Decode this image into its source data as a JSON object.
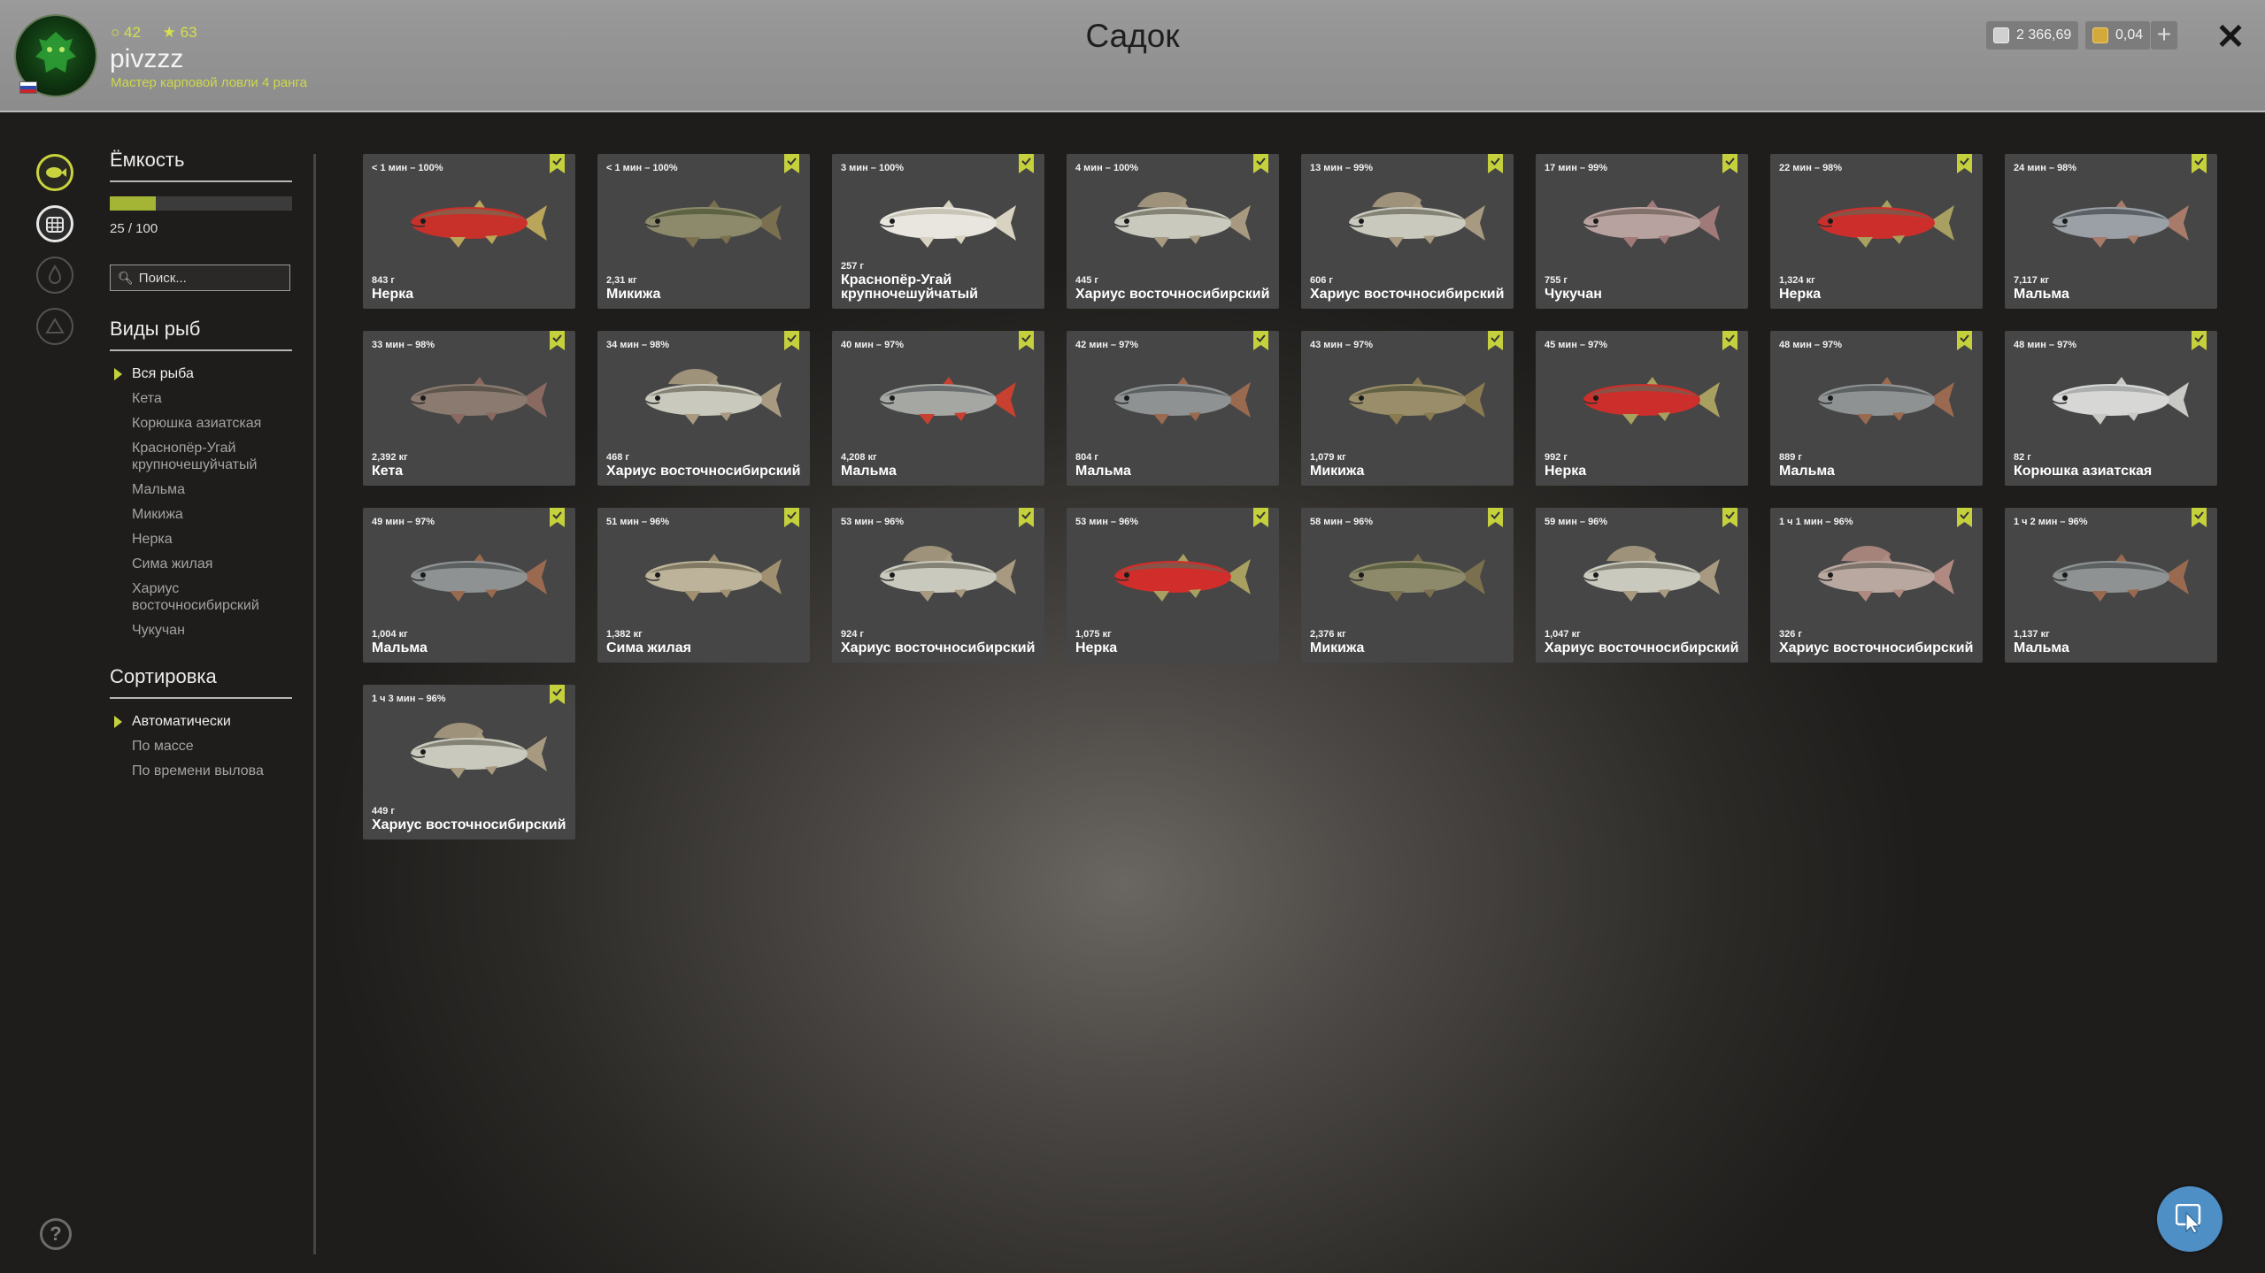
{
  "header": {
    "title": "Садок",
    "player": {
      "username": "pivzzz",
      "rank_text": "Мастер карповой ловли 4 ранга",
      "stat1": "42",
      "stat2": "63"
    },
    "currency": {
      "silver": "2 366,69",
      "gold": "0,04"
    },
    "plus_label": "+",
    "close_label": "✕",
    "accent_color": "#c4d13d"
  },
  "sidebar": {
    "capacity": {
      "title": "Ёмкость",
      "text": "25 / 100",
      "fill_fraction": 0.25
    },
    "search_placeholder": "Поиск...",
    "species": {
      "title": "Виды рыб",
      "items": [
        "Вся рыба",
        "Кета",
        "Корюшка азиатская",
        "Краснопёр-Угай крупночешуйчатый",
        "Мальма",
        "Микижа",
        "Нерка",
        "Сима жилая",
        "Хариус восточносибирский",
        "Чукучан"
      ],
      "selected_index": 0
    },
    "sort": {
      "title": "Сортировка",
      "items": [
        "Автоматически",
        "По массе",
        "По времени вылова"
      ],
      "selected_index": 0
    },
    "help_label": "?"
  },
  "fish": [
    {
      "time": "< 1 мин – 100%",
      "weight": "843 г",
      "name": "Нерка",
      "icon": "fish-sockeye-icon",
      "body": "#c8302a",
      "back": "#7a6a52",
      "fin": "#b9a65a"
    },
    {
      "time": "< 1 мин – 100%",
      "weight": "2,31 кг",
      "name": "Микижа",
      "icon": "fish-rainbow-trout-icon",
      "body": "#8c8a6a",
      "back": "#4d5436",
      "fin": "#7a7050"
    },
    {
      "time": "3 мин – 100%",
      "weight": "257 г",
      "name": "Краснопёр-Угай крупночешуйчатый",
      "icon": "fish-redfin-icon",
      "body": "#e8e6df",
      "back": "#bdb8a8",
      "fin": "#d8d2c0"
    },
    {
      "time": "4 мин – 100%",
      "weight": "445 г",
      "name": "Хариус восточносибирский",
      "icon": "fish-grayling-icon",
      "body": "#c9c9bd",
      "back": "#6b6a5c",
      "fin": "#a89a80",
      "sail": true
    },
    {
      "time": "13 мин – 99%",
      "weight": "606 г",
      "name": "Хариус восточносибирский",
      "icon": "fish-grayling-icon",
      "body": "#c9c9bd",
      "back": "#6b6a5c",
      "fin": "#a89a80",
      "sail": true
    },
    {
      "time": "17 мин – 99%",
      "weight": "755 г",
      "name": "Чукучан",
      "icon": "fish-sucker-icon",
      "body": "#b8a2a0",
      "back": "#706058",
      "fin": "#a07a78"
    },
    {
      "time": "22 мин – 98%",
      "weight": "1,324 кг",
      "name": "Нерка",
      "icon": "fish-sockeye-icon",
      "body": "#cc2f2b",
      "back": "#6e6252",
      "fin": "#a8a060"
    },
    {
      "time": "24 мин – 98%",
      "weight": "7,117 кг",
      "name": "Мальма",
      "icon": "fish-dolly-varden-icon",
      "body": "#9aa0a6",
      "back": "#454b52",
      "fin": "#a87a6a"
    },
    {
      "time": "33 мин – 98%",
      "weight": "2,392 кг",
      "name": "Кета",
      "icon": "fish-chum-icon",
      "body": "#8a7a70",
      "back": "#4e4a40",
      "fin": "#8a6a60"
    },
    {
      "time": "34 мин – 98%",
      "weight": "468 г",
      "name": "Хариус восточносибирский",
      "icon": "fish-grayling-icon",
      "body": "#c9c9bd",
      "back": "#6b6a5c",
      "fin": "#a89a80",
      "sail": true
    },
    {
      "time": "40 мин – 97%",
      "weight": "4,208 кг",
      "name": "Мальма",
      "icon": "fish-dolly-varden-icon",
      "body": "#a5a7a2",
      "back": "#55585a",
      "fin": "#c8402f"
    },
    {
      "time": "42 мин – 97%",
      "weight": "804 г",
      "name": "Мальма",
      "icon": "fish-dolly-varden-icon",
      "body": "#8e9292",
      "back": "#4b4f50",
      "fin": "#9a6a50"
    },
    {
      "time": "43 мин – 97%",
      "weight": "1,079 кг",
      "name": "Микижа",
      "icon": "fish-rainbow-trout-icon",
      "body": "#9a8e6a",
      "back": "#4f5238",
      "fin": "#8a7a50"
    },
    {
      "time": "45 мин – 97%",
      "weight": "992 г",
      "name": "Нерка",
      "icon": "fish-sockeye-icon",
      "body": "#cc2f2b",
      "back": "#6e6252",
      "fin": "#a8a060"
    },
    {
      "time": "48 мин – 97%",
      "weight": "889 г",
      "name": "Мальма",
      "icon": "fish-dolly-varden-icon",
      "body": "#8e9292",
      "back": "#4b4f50",
      "fin": "#9a6a50"
    },
    {
      "time": "48 мин – 97%",
      "weight": "82 г",
      "name": "Корюшка азиатская",
      "icon": "fish-smelt-icon",
      "body": "#d7d8d6",
      "back": "#9ea0a0",
      "fin": "#c8c8c4"
    },
    {
      "time": "49 мин – 97%",
      "weight": "1,004 кг",
      "name": "Мальма",
      "icon": "fish-dolly-varden-icon",
      "body": "#8e9292",
      "back": "#4b4f50",
      "fin": "#9a6a50"
    },
    {
      "time": "51 мин – 96%",
      "weight": "1,382 кг",
      "name": "Сима жилая",
      "icon": "fish-masu-icon",
      "body": "#bdb39a",
      "back": "#6e6650",
      "fin": "#a09070"
    },
    {
      "time": "53 мин – 96%",
      "weight": "924 г",
      "name": "Хариус восточносибирский",
      "icon": "fish-grayling-icon",
      "body": "#c9c9bd",
      "back": "#6b6a5c",
      "fin": "#a89a80",
      "sail": true
    },
    {
      "time": "53 мин – 96%",
      "weight": "1,075 кг",
      "name": "Нерка",
      "icon": "fish-sockeye-icon",
      "body": "#d12d2a",
      "back": "#6e6252",
      "fin": "#a8a060"
    },
    {
      "time": "58 мин – 96%",
      "weight": "2,376 кг",
      "name": "Микижа",
      "icon": "fish-rainbow-trout-icon",
      "body": "#8c8a6a",
      "back": "#4d5436",
      "fin": "#7a7050"
    },
    {
      "time": "59 мин – 96%",
      "weight": "1,047 кг",
      "name": "Хариус восточносибирский",
      "icon": "fish-grayling-icon",
      "body": "#c9c9bd",
      "back": "#6b6a5c",
      "fin": "#a89a80",
      "sail": true
    },
    {
      "time": "1 ч 1 мин – 96%",
      "weight": "326 г",
      "name": "Хариус восточносибирский",
      "icon": "fish-grayling-icon",
      "body": "#b8a8a0",
      "back": "#6b6258",
      "fin": "#b08a80",
      "sail": true
    },
    {
      "time": "1 ч 2 мин – 96%",
      "weight": "1,137 кг",
      "name": "Мальма",
      "icon": "fish-dolly-varden-icon",
      "body": "#8e9292",
      "back": "#4b4f50",
      "fin": "#9a6a50"
    },
    {
      "time": "1 ч 3 мин – 96%",
      "weight": "449 г",
      "name": "Хариус восточносибирский",
      "icon": "fish-grayling-icon",
      "body": "#c9c9bd",
      "back": "#6b6a5c",
      "fin": "#a89a80",
      "sail": true
    }
  ]
}
